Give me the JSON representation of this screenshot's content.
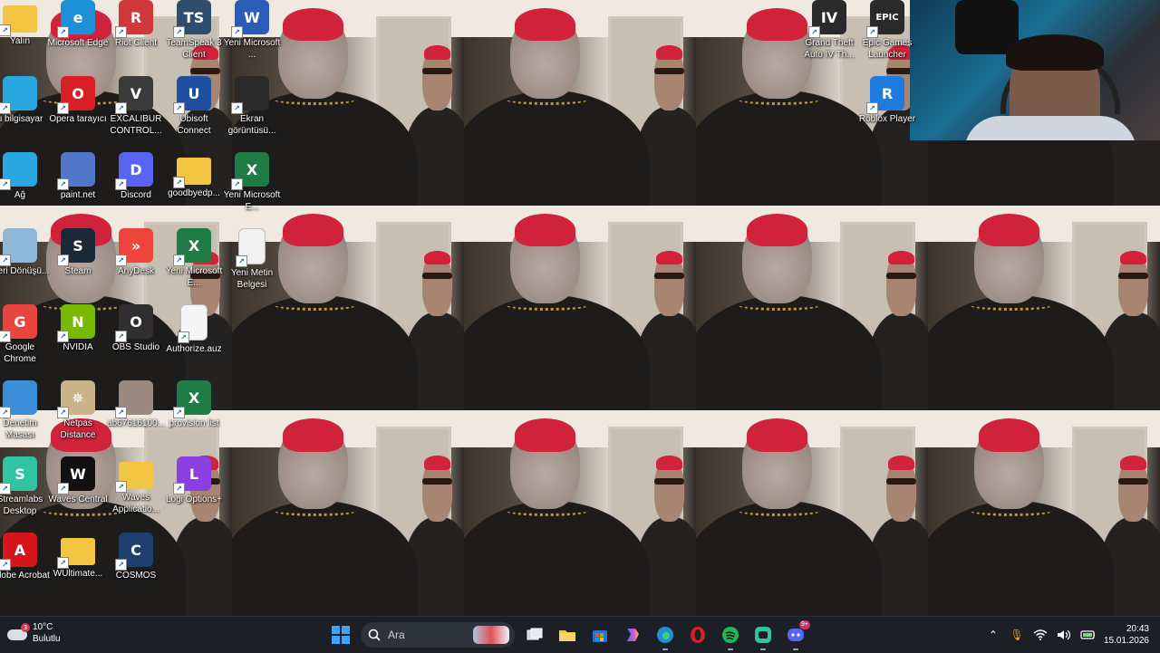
{
  "desktop": {
    "icons": [
      {
        "label": "Yalın",
        "icon": "folder-user-icon",
        "color": "#f4c542"
      },
      {
        "label": "Microsoft Edge",
        "icon": "edge-icon",
        "color": "#1e90d8"
      },
      {
        "label": "Riot Client",
        "icon": "riot-icon",
        "color": "#d13639"
      },
      {
        "label": "TeamSpeak 3 Client",
        "icon": "teamspeak-icon",
        "color": "#2f4d6c"
      },
      {
        "label": "Yeni Microsoft ...",
        "icon": "word-icon",
        "color": "#2b5cb8"
      },
      {
        "label": "u bilgisayar",
        "icon": "computer-icon",
        "color": "#2aa6e0"
      },
      {
        "label": "Opera tarayıcı",
        "icon": "opera-icon",
        "color": "#d91f26"
      },
      {
        "label": "EXCALIBUR CONTROL...",
        "icon": "excalibur-icon",
        "color": "#3a3a3a"
      },
      {
        "label": "Ubisoft Connect",
        "icon": "ubisoft-icon",
        "color": "#1e4fa0"
      },
      {
        "label": "Ekran görüntüsü...",
        "icon": "screenshot-icon",
        "color": "#2a2a2a"
      },
      {
        "label": "Ağ",
        "icon": "network-icon",
        "color": "#2aa6e0"
      },
      {
        "label": "paint.net",
        "icon": "paintnet-icon",
        "color": "#5277c9"
      },
      {
        "label": "Discord",
        "icon": "discord-icon",
        "color": "#5865f2"
      },
      {
        "label": "goodbyedp...",
        "icon": "folder-icon",
        "color": "#f4c542"
      },
      {
        "label": "Yeni Microsoft E...",
        "icon": "excel-icon",
        "color": "#1e7b45"
      },
      {
        "label": "Geri Dönüşü...",
        "icon": "recycle-bin-icon",
        "color": "#8fb8d8"
      },
      {
        "label": "Steam",
        "icon": "steam-icon",
        "color": "#1b2838"
      },
      {
        "label": "AnyDesk",
        "icon": "anydesk-icon",
        "color": "#ef443b"
      },
      {
        "label": "Yeni Microsoft E...",
        "icon": "excel-icon",
        "color": "#1e7b45"
      },
      {
        "label": "Yeni Metin Belgesi",
        "icon": "text-file-icon",
        "color": "#f0f0f0"
      },
      {
        "label": "Google Chrome",
        "icon": "chrome-icon",
        "color": "#e8453c"
      },
      {
        "label": "NVIDIA",
        "icon": "nvidia-icon",
        "color": "#76b900"
      },
      {
        "label": "OBS Studio",
        "icon": "obs-icon",
        "color": "#302e31"
      },
      {
        "label": "Authorize.auz",
        "icon": "blank-file-icon",
        "color": "#f5f5f5"
      },
      {
        "label": "Denetim Masası",
        "icon": "control-panel-icon",
        "color": "#3b8fd9"
      },
      {
        "label": "Netpas Distance",
        "icon": "netpas-icon",
        "color": "#c9b48a"
      },
      {
        "label": "ab67616100...",
        "icon": "image-file-icon",
        "color": "#9a8a80"
      },
      {
        "label": "provision list",
        "icon": "excel-icon",
        "color": "#1e7b45"
      },
      {
        "label": "Streamlabs Desktop",
        "icon": "streamlabs-icon",
        "color": "#31c3a2"
      },
      {
        "label": "Waves Central",
        "icon": "waves-icon",
        "color": "#111111"
      },
      {
        "label": "Waves Applicatio...",
        "icon": "folder-icon",
        "color": "#f4c542"
      },
      {
        "label": "Logi Options+",
        "icon": "logi-icon",
        "color": "#8b3fe0"
      },
      {
        "label": "Adobe Acrobat",
        "icon": "acrobat-icon",
        "color": "#d4161c"
      },
      {
        "label": "WUltimate...",
        "icon": "folder-icon",
        "color": "#f4c542"
      },
      {
        "label": "COSMOS",
        "icon": "cosmos-icon",
        "color": "#1d3f6e"
      },
      {
        "label": "Grand Theft Auto IV Th...",
        "icon": "gta-icon",
        "color": "#2a2a2a"
      },
      {
        "label": "Epic Games Launcher",
        "icon": "epic-icon",
        "color": "#2a2a2a"
      },
      {
        "label": "Roblox Player",
        "icon": "roblox-icon",
        "color": "#1e7ce0"
      }
    ]
  },
  "icon_glyphs": {
    "edge": "e",
    "riot": "R",
    "teamspeak": "TS",
    "word": "W",
    "opera": "O",
    "excalibur": "V",
    "ubisoft": "U",
    "discord": "D",
    "excel": "X",
    "steam": "S",
    "anydesk": "»",
    "chrome": "G",
    "nvidia": "N",
    "obs": "O",
    "netpas": "✵",
    "streamlabs": "S",
    "waves": "W",
    "logi": "L",
    "acrobat": "A",
    "cosmos": "C",
    "gta": "IV",
    "epic": "EPIC",
    "roblox": "R"
  },
  "taskbar": {
    "weather": {
      "temp": "10°C",
      "condition": "Bulutlu",
      "badge": "3"
    },
    "search_placeholder": "Ara",
    "apps": [
      "task-view",
      "file-explorer",
      "microsoft-store",
      "copilot",
      "edge",
      "opera",
      "spotify",
      "streamlabs",
      "discord"
    ],
    "clock": {
      "time": "20:43",
      "date": "15.01.2026"
    },
    "discord_badge": "9+"
  },
  "colors": {
    "taskbar_bg": "#1c1f26",
    "accent": "#3aa2ff"
  }
}
